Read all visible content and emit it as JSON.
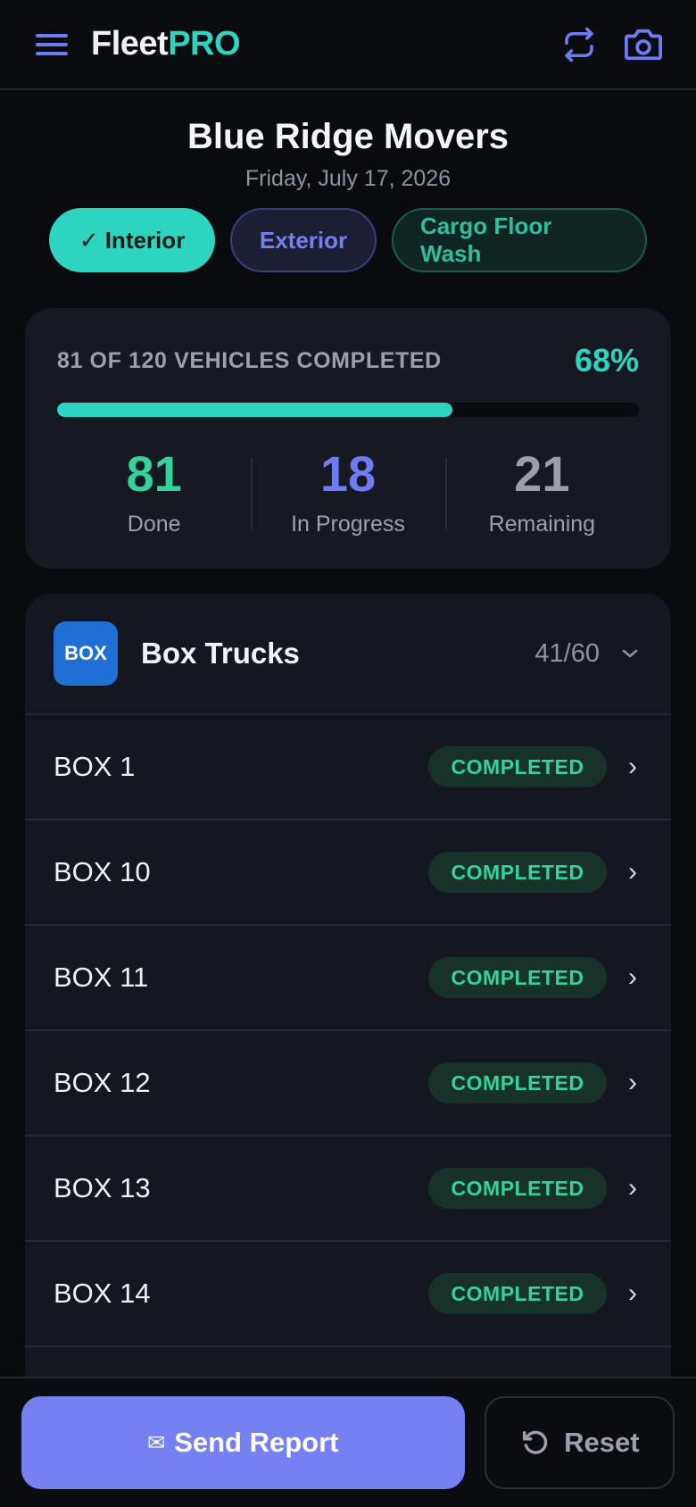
{
  "header": {
    "brand_part1": "Fleet",
    "brand_part2": "PRO",
    "menu_icon": "hamburger-menu-icon",
    "sync_icon": "sync-icon",
    "camera_icon": "camera-icon"
  },
  "title": {
    "company": "Blue Ridge Movers",
    "date": "Friday, July 17, 2026"
  },
  "tabs": [
    {
      "label": "✓ Interior",
      "active": true
    },
    {
      "label": "Exterior",
      "active": false
    },
    {
      "label": "Cargo Floor Wash",
      "active": false
    }
  ],
  "progress": {
    "label": "81 OF 120 VEHICLES COMPLETED",
    "percent_text": "68%",
    "fill_fraction": 0.68,
    "stats": [
      {
        "value": "81",
        "label": "Done"
      },
      {
        "value": "18",
        "label": "In Progress"
      },
      {
        "value": "21",
        "label": "Remaining"
      }
    ]
  },
  "group": {
    "badge": "BOX",
    "title": "Box Trucks",
    "count": "41/60",
    "rows": [
      {
        "name": "BOX 1",
        "status": "COMPLETED"
      },
      {
        "name": "BOX 10",
        "status": "COMPLETED"
      },
      {
        "name": "BOX 11",
        "status": "COMPLETED"
      },
      {
        "name": "BOX 12",
        "status": "COMPLETED"
      },
      {
        "name": "BOX 13",
        "status": "COMPLETED"
      },
      {
        "name": "BOX 14",
        "status": "COMPLETED"
      }
    ]
  },
  "actions": {
    "send_icon": "✉",
    "send_label": "Send Report",
    "reset_label": "Reset"
  },
  "colors": {
    "accent_teal": "#2dd4bf",
    "accent_indigo": "#7580f1",
    "done_green": "#34d399",
    "box_badge_blue": "#1f6fd6",
    "background": "#0a0b0e"
  }
}
